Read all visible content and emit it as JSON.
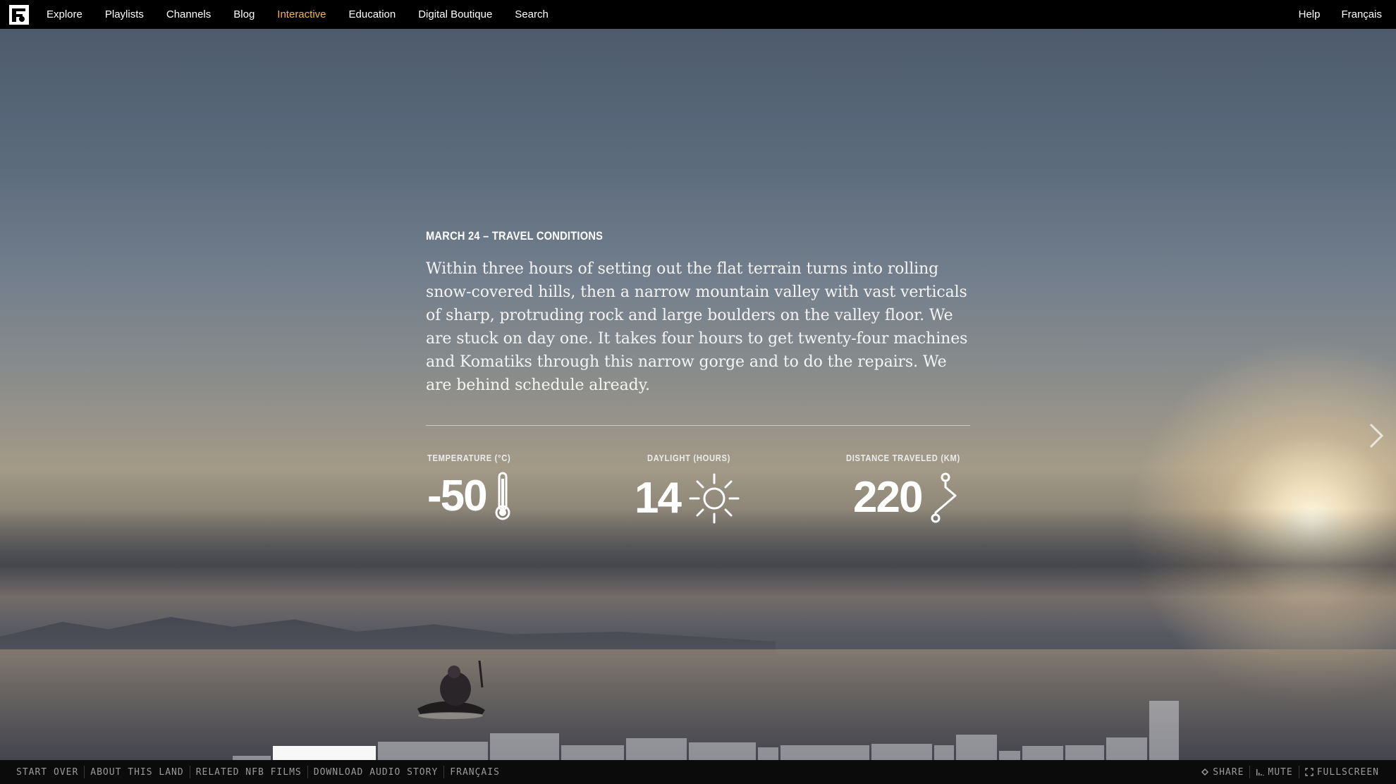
{
  "nav": {
    "logo": "nfb-logo",
    "items": [
      {
        "label": "Explore"
      },
      {
        "label": "Playlists"
      },
      {
        "label": "Channels"
      },
      {
        "label": "Blog"
      },
      {
        "label": "Interactive",
        "active": true
      },
      {
        "label": "Education"
      },
      {
        "label": "Digital Boutique"
      },
      {
        "label": "Search"
      }
    ],
    "right_items": [
      {
        "label": "Help"
      },
      {
        "label": "Français"
      }
    ],
    "active_color": "#f6b54a"
  },
  "entry": {
    "heading": "MARCH 24 – TRAVEL CONDITIONS",
    "body": "Within three hours of setting out the flat terrain turns into rolling snow-covered hills, then a narrow mountain valley with vast verticals of sharp, protruding rock and large boulders on the valley floor. We are stuck on day one. It takes four hours to get twenty-four machines and Komatiks through this narrow gorge and to do the repairs. We are behind schedule already."
  },
  "stats": [
    {
      "label": "TEMPERATURE (°C)",
      "value": "-50",
      "icon": "thermometer-icon"
    },
    {
      "label": "DAYLIGHT (HOURS)",
      "value": "14",
      "icon": "sun-icon"
    },
    {
      "label": "DISTANCE TRAVELED (KM)",
      "value": "220",
      "icon": "route-icon"
    }
  ],
  "timeline": {
    "current_index": 1,
    "segments": [
      {
        "height": 0.06
      },
      {
        "height": 0.2
      },
      {
        "height": 0.26
      },
      {
        "height": 0.38
      },
      {
        "height": 0.21
      },
      {
        "height": 0.31
      },
      {
        "height": 0.25
      },
      {
        "height": 0.18
      },
      {
        "height": 0.21
      },
      {
        "height": 0.23
      },
      {
        "height": 0.21
      },
      {
        "height": 0.36
      },
      {
        "height": 0.13
      },
      {
        "height": 0.2
      },
      {
        "height": 0.21
      },
      {
        "height": 0.32
      },
      {
        "height": 0.84
      }
    ]
  },
  "footer": {
    "left_items": [
      {
        "label": "START OVER"
      },
      {
        "label": "ABOUT THIS LAND"
      },
      {
        "label": "RELATED NFB FILMS"
      },
      {
        "label": "DOWNLOAD AUDIO STORY"
      },
      {
        "label": "FRANÇAIS"
      }
    ],
    "right_items": [
      {
        "label": "SHARE",
        "icon": "share-icon"
      },
      {
        "label": "MUTE",
        "icon": "volume-icon"
      },
      {
        "label": "FULLSCREEN",
        "icon": "fullscreen-icon"
      }
    ]
  }
}
